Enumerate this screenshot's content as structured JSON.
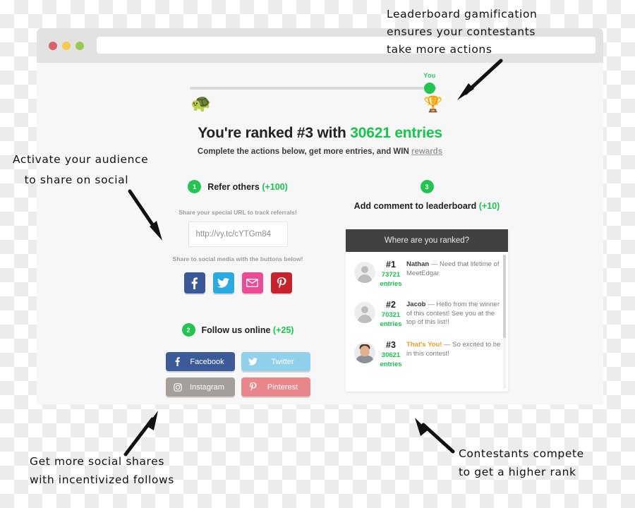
{
  "browser": {
    "traffic_lights": [
      "close",
      "minimize",
      "maximize"
    ],
    "address_value": "",
    "address_placeholder": ""
  },
  "progress": {
    "start_icon": "turtle-icon",
    "end_icon": "trophy-icon",
    "marker_label": "You",
    "marker_color": "#23c552"
  },
  "headline": {
    "prefix": "You're ranked #3 with ",
    "highlight": "30621 entries",
    "rank": "#3",
    "entries": "30621"
  },
  "subline": {
    "text": "Complete the actions below, get more entries, and WIN ",
    "link": "rewards"
  },
  "steps": [
    {
      "number": "1",
      "title": "Refer others ",
      "points": "(+100)"
    },
    {
      "number": "2",
      "title": "Follow us online ",
      "points": "(+25)"
    },
    {
      "number": "3",
      "title": "Add comment to leaderboard ",
      "points": "(+10)"
    }
  ],
  "refer": {
    "url_hint": "Share your special URL to track referrals!",
    "url_value": "http://vy.tc/cYTGm84",
    "social_hint": "Share to social media with the buttons below!",
    "share_buttons": [
      {
        "name": "facebook",
        "icon": "facebook-icon",
        "color": "#3b5998"
      },
      {
        "name": "twitter",
        "icon": "twitter-icon",
        "color": "#29aae1"
      },
      {
        "name": "email",
        "icon": "envelope-icon",
        "color": "#ed4b96"
      },
      {
        "name": "pinterest",
        "icon": "pinterest-icon",
        "color": "#c8232c"
      }
    ]
  },
  "follow": {
    "buttons": [
      {
        "label": "Facebook",
        "icon": "facebook-icon",
        "color": "#3c5a9a"
      },
      {
        "label": "Twitter",
        "icon": "twitter-icon",
        "color": "#8fd0ea"
      },
      {
        "label": "Instagram",
        "icon": "instagram-icon",
        "color": "#a59f9c"
      },
      {
        "label": "Pinterest",
        "icon": "pinterest-icon",
        "color": "#e8868c"
      }
    ]
  },
  "leaderboard": {
    "header": "Where are you ranked?",
    "rows": [
      {
        "rank": "#1",
        "entries": "73721",
        "entries_label": "entries",
        "author": "Nathan",
        "dash": " — ",
        "comment": "Need that lifetime of MeetEdgar",
        "is_you": false,
        "avatar": "default-avatar"
      },
      {
        "rank": "#2",
        "entries": "70321",
        "entries_label": "entries",
        "author": "Jacob",
        "dash": " — ",
        "comment": "Hello from the winner of this contest! See you at the top of this list!!",
        "is_you": false,
        "avatar": "default-avatar"
      },
      {
        "rank": "#3",
        "entries": "30621",
        "entries_label": "entries",
        "author": "That's You!",
        "dash": " — ",
        "comment": "So excited to be in this contest!",
        "is_you": true,
        "avatar": "photo-avatar"
      }
    ]
  },
  "annotations": {
    "top": "Leaderboard gamification\nensures your contestants\ntake more actions",
    "left": "Activate your audience\n   to share on social",
    "bottom_left": "Get more social shares\nwith incentivized follows",
    "bottom_right": "Contestants compete\nto get a higher rank"
  }
}
